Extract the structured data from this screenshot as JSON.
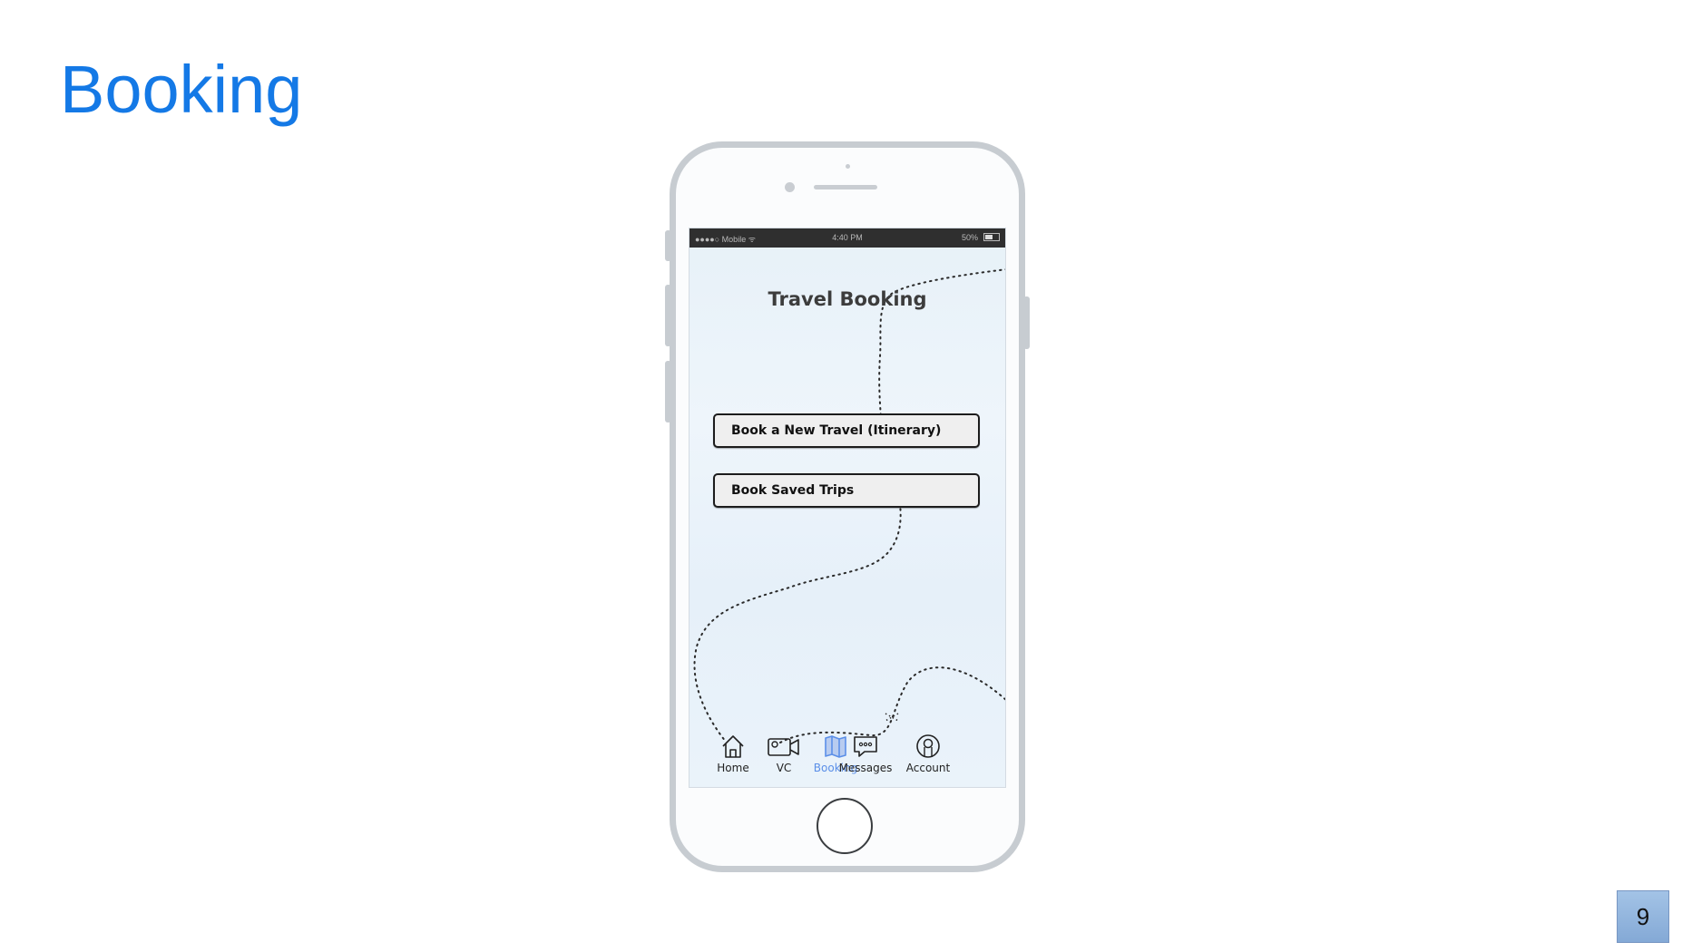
{
  "slide": {
    "title": "Booking",
    "page_number": "9"
  },
  "status_bar": {
    "carrier": "●●●●○ Mobile ᯤ",
    "time": "4:40 PM",
    "battery": "50%"
  },
  "app": {
    "title": "Travel Booking",
    "buttons": {
      "new_travel": "Book a New Travel (Itinerary)",
      "saved_trips": "Book Saved Trips"
    }
  },
  "tab_bar": {
    "active": "Booking",
    "active_color": "#5b8fe8",
    "tabs": [
      {
        "label": "Home",
        "icon": "home-icon"
      },
      {
        "label": "VC",
        "icon": "video-camera-icon"
      },
      {
        "label": "Booking",
        "icon": "map-icon"
      },
      {
        "label": "Messages",
        "icon": "chat-icon"
      },
      {
        "label": "Account",
        "icon": "user-icon"
      }
    ]
  },
  "colors": {
    "title": "#1479e6",
    "page_number_bg": "#94b6df"
  }
}
